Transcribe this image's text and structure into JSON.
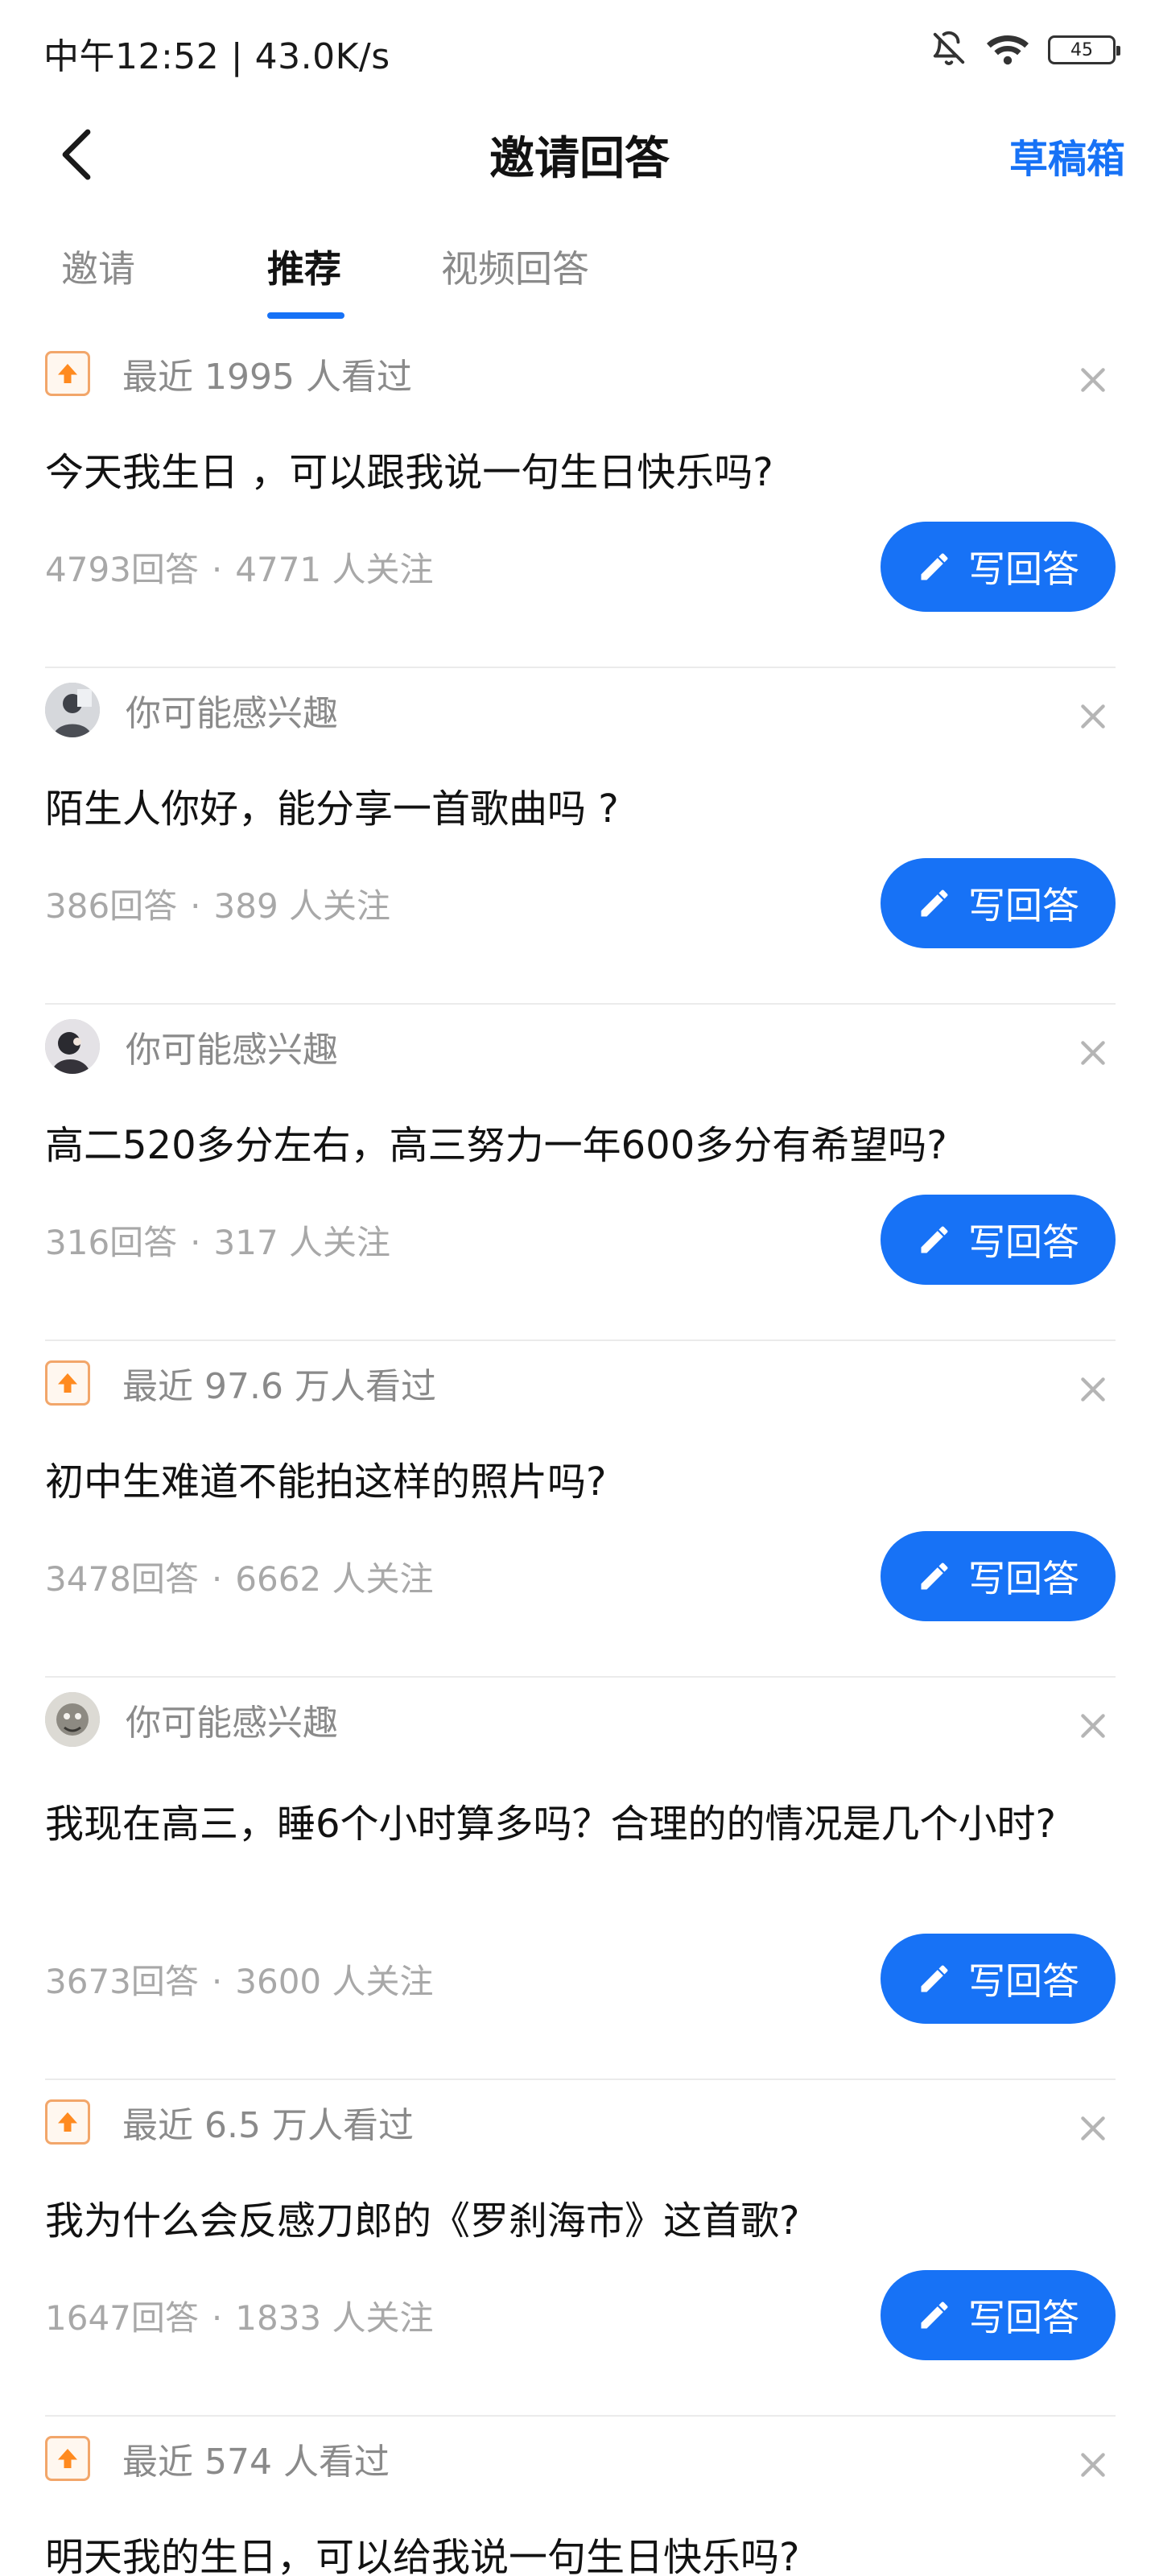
{
  "status_bar": {
    "time_speed": "中午12:52 | 43.0K/s",
    "battery": "45"
  },
  "header": {
    "title": "邀请回答",
    "drafts": "草稿箱"
  },
  "tabs": [
    {
      "label": "邀请"
    },
    {
      "label": "推荐"
    },
    {
      "label": "视频回答"
    }
  ],
  "colors": {
    "accent": "#1772f6",
    "muted": "#8a8a8a",
    "trend": "#f2a66a"
  },
  "cards": [
    {
      "reason_type": "trending",
      "reason": "最近 1995 人看过",
      "question": "今天我生日 ，可以跟我说一句生日快乐吗?",
      "answers": "4793回答",
      "followers": "4771 人关注",
      "action": "写回答"
    },
    {
      "reason_type": "interest",
      "reason": "你可能感兴趣",
      "question": "陌生人你好，能分享一首歌曲吗 ?",
      "answers": "386回答",
      "followers": "389 人关注",
      "action": "写回答"
    },
    {
      "reason_type": "interest",
      "reason": "你可能感兴趣",
      "question": "高二520多分左右，高三努力一年600多分有希望吗?",
      "answers": "316回答",
      "followers": "317 人关注",
      "action": "写回答"
    },
    {
      "reason_type": "trending",
      "reason": "最近 97.6 万人看过",
      "question": "初中生难道不能拍这样的照片吗?",
      "answers": "3478回答",
      "followers": "6662 人关注",
      "action": "写回答"
    },
    {
      "reason_type": "interest",
      "reason": "你可能感兴趣",
      "question": "我现在高三，睡6个小时算多吗？合理的的情况是几个小时?",
      "answers": "3673回答",
      "followers": "3600 人关注",
      "action": "写回答"
    },
    {
      "reason_type": "trending",
      "reason": "最近 6.5 万人看过",
      "question": "我为什么会反感刀郎的《罗刹海市》这首歌?",
      "answers": "1647回答",
      "followers": "1833 人关注",
      "action": "写回答"
    },
    {
      "reason_type": "trending",
      "reason": "最近 574 人看过",
      "question": "明天我的生日，可以给我说一句生日快乐吗?",
      "answers": "",
      "followers": "",
      "action": ""
    }
  ],
  "meta_separator": "·",
  "icons": {
    "back": "chevron-left-icon",
    "dismiss": "close-icon",
    "trend": "arrow-up-icon",
    "pen": "pencil-icon",
    "mute": "bell-off-icon",
    "wifi": "wifi-icon",
    "battery": "battery-icon"
  }
}
